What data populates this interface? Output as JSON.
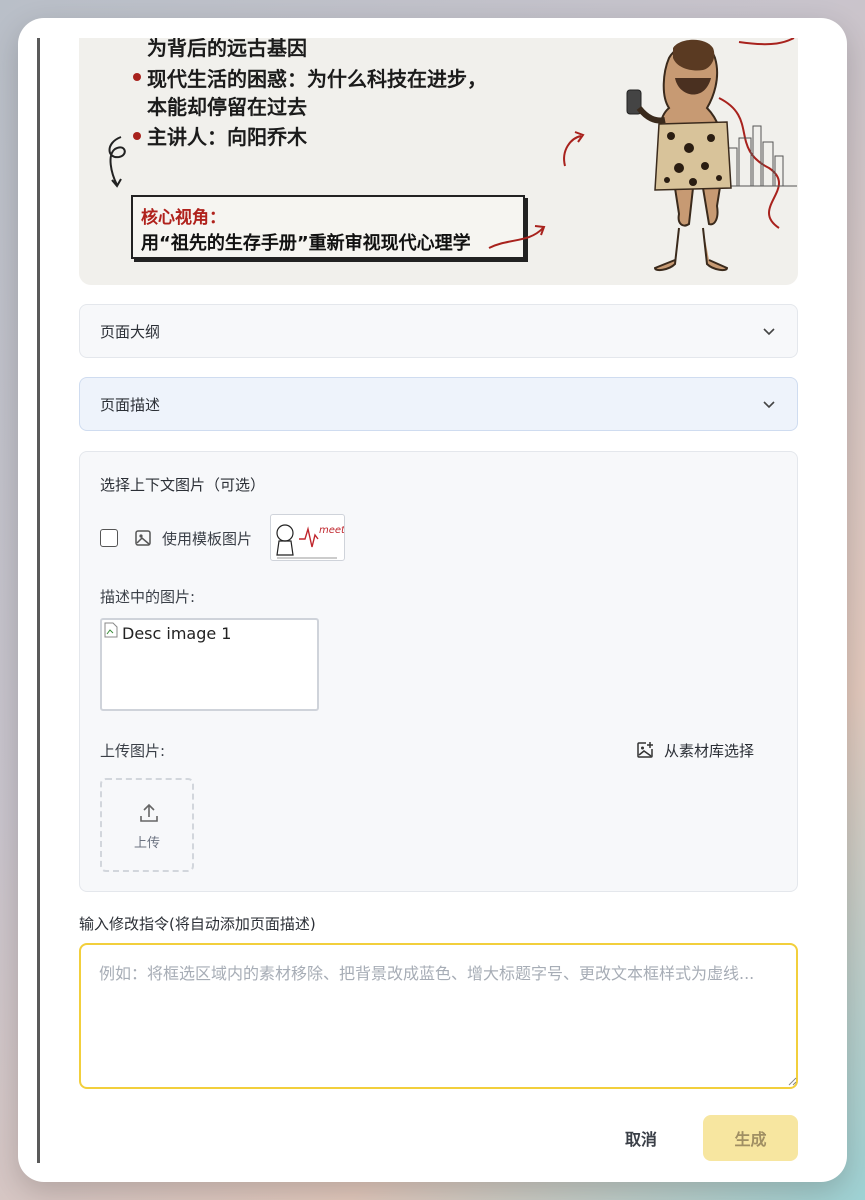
{
  "preview": {
    "line_partial": "为背后的远古基因",
    "bullet_2a": "现代生活的困惑：为什么科技在进步，",
    "bullet_2b": "本能却停留在过去",
    "bullet_3": "主讲人：向阳乔木",
    "core_title": "核心视角：",
    "core_desc": "用“祖先的生存手册”重新审视现代心理学",
    "accent_color": "#a8221d"
  },
  "accordions": {
    "outline_label": "页面大纲",
    "description_label": "页面描述"
  },
  "context": {
    "title": "选择上下文图片（可选）",
    "template_label": "使用模板图片",
    "template_thumb_text": "meet",
    "desc_images_label": "描述中的图片:",
    "desc_image_alt": "Desc image 1",
    "upload_label": "上传图片:",
    "library_button": "从素材库选择",
    "upload_button": "上传"
  },
  "instruction": {
    "label": "输入修改指令(将自动添加页面描述)",
    "placeholder": "例如：将框选区域内的素材移除、把背景改成蓝色、增大标题字号、更改文本框样式为虚线...",
    "value": ""
  },
  "footer": {
    "cancel_label": "取消",
    "generate_label": "生成",
    "generate_color": "#f7e6a0"
  }
}
